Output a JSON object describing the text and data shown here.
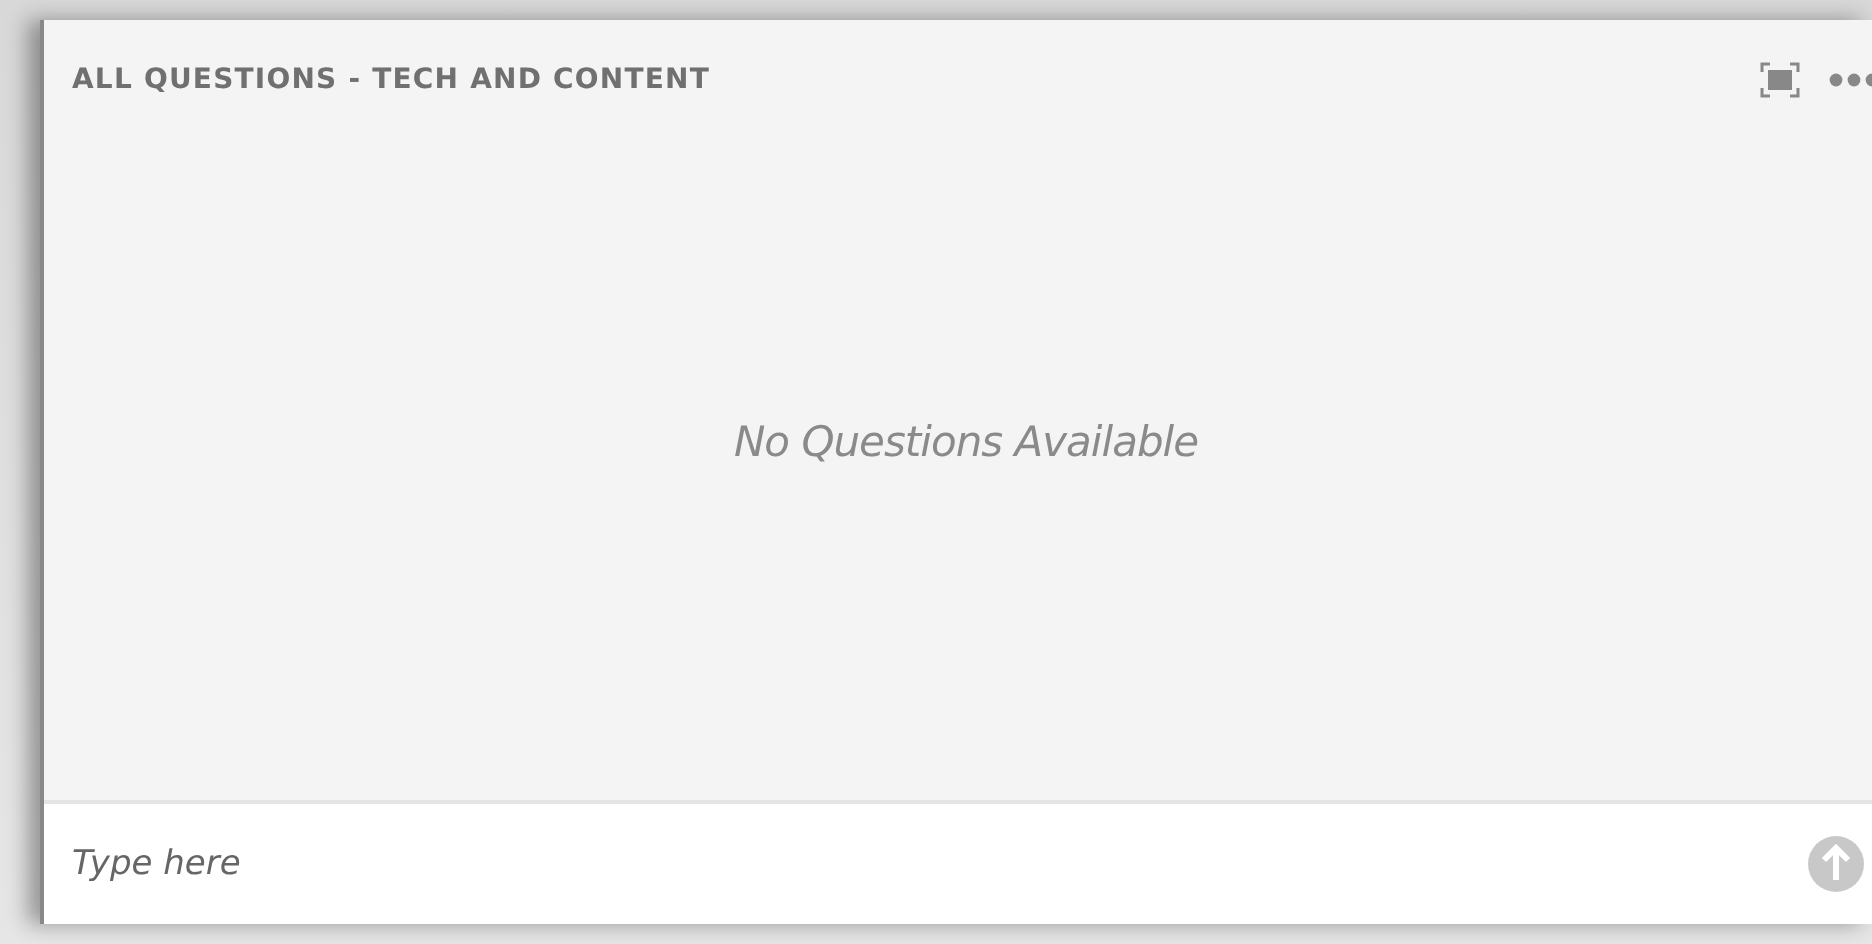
{
  "panel": {
    "title": "ALL QUESTIONS - TECH AND CONTENT"
  },
  "empty_message": "No Questions Available",
  "input": {
    "placeholder": "Type here"
  }
}
